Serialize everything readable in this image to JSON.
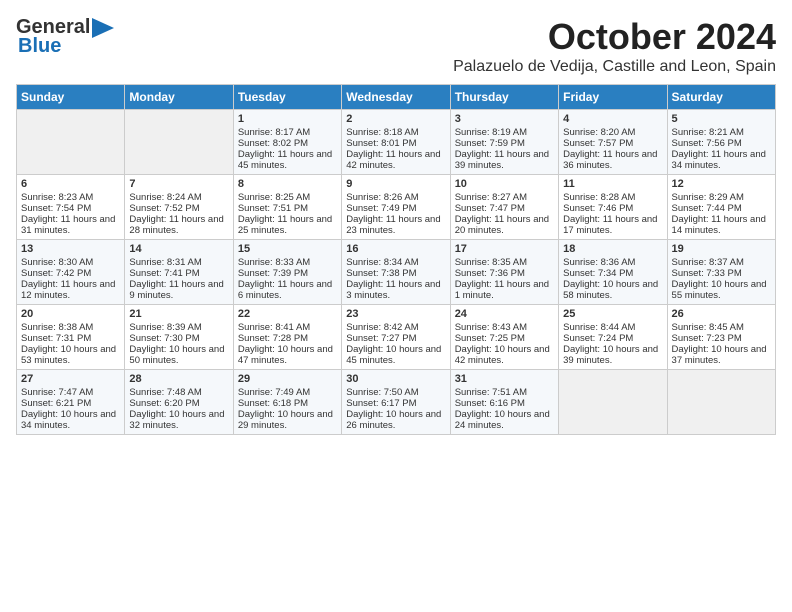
{
  "header": {
    "logo_line1": "General",
    "logo_line2": "Blue",
    "month": "October 2024",
    "location": "Palazuelo de Vedija, Castille and Leon, Spain"
  },
  "days_of_week": [
    "Sunday",
    "Monday",
    "Tuesday",
    "Wednesday",
    "Thursday",
    "Friday",
    "Saturday"
  ],
  "weeks": [
    [
      {
        "day": "",
        "content": ""
      },
      {
        "day": "",
        "content": ""
      },
      {
        "day": "1",
        "content": "Sunrise: 8:17 AM\nSunset: 8:02 PM\nDaylight: 11 hours and 45 minutes."
      },
      {
        "day": "2",
        "content": "Sunrise: 8:18 AM\nSunset: 8:01 PM\nDaylight: 11 hours and 42 minutes."
      },
      {
        "day": "3",
        "content": "Sunrise: 8:19 AM\nSunset: 7:59 PM\nDaylight: 11 hours and 39 minutes."
      },
      {
        "day": "4",
        "content": "Sunrise: 8:20 AM\nSunset: 7:57 PM\nDaylight: 11 hours and 36 minutes."
      },
      {
        "day": "5",
        "content": "Sunrise: 8:21 AM\nSunset: 7:56 PM\nDaylight: 11 hours and 34 minutes."
      }
    ],
    [
      {
        "day": "6",
        "content": "Sunrise: 8:23 AM\nSunset: 7:54 PM\nDaylight: 11 hours and 31 minutes."
      },
      {
        "day": "7",
        "content": "Sunrise: 8:24 AM\nSunset: 7:52 PM\nDaylight: 11 hours and 28 minutes."
      },
      {
        "day": "8",
        "content": "Sunrise: 8:25 AM\nSunset: 7:51 PM\nDaylight: 11 hours and 25 minutes."
      },
      {
        "day": "9",
        "content": "Sunrise: 8:26 AM\nSunset: 7:49 PM\nDaylight: 11 hours and 23 minutes."
      },
      {
        "day": "10",
        "content": "Sunrise: 8:27 AM\nSunset: 7:47 PM\nDaylight: 11 hours and 20 minutes."
      },
      {
        "day": "11",
        "content": "Sunrise: 8:28 AM\nSunset: 7:46 PM\nDaylight: 11 hours and 17 minutes."
      },
      {
        "day": "12",
        "content": "Sunrise: 8:29 AM\nSunset: 7:44 PM\nDaylight: 11 hours and 14 minutes."
      }
    ],
    [
      {
        "day": "13",
        "content": "Sunrise: 8:30 AM\nSunset: 7:42 PM\nDaylight: 11 hours and 12 minutes."
      },
      {
        "day": "14",
        "content": "Sunrise: 8:31 AM\nSunset: 7:41 PM\nDaylight: 11 hours and 9 minutes."
      },
      {
        "day": "15",
        "content": "Sunrise: 8:33 AM\nSunset: 7:39 PM\nDaylight: 11 hours and 6 minutes."
      },
      {
        "day": "16",
        "content": "Sunrise: 8:34 AM\nSunset: 7:38 PM\nDaylight: 11 hours and 3 minutes."
      },
      {
        "day": "17",
        "content": "Sunrise: 8:35 AM\nSunset: 7:36 PM\nDaylight: 11 hours and 1 minute."
      },
      {
        "day": "18",
        "content": "Sunrise: 8:36 AM\nSunset: 7:34 PM\nDaylight: 10 hours and 58 minutes."
      },
      {
        "day": "19",
        "content": "Sunrise: 8:37 AM\nSunset: 7:33 PM\nDaylight: 10 hours and 55 minutes."
      }
    ],
    [
      {
        "day": "20",
        "content": "Sunrise: 8:38 AM\nSunset: 7:31 PM\nDaylight: 10 hours and 53 minutes."
      },
      {
        "day": "21",
        "content": "Sunrise: 8:39 AM\nSunset: 7:30 PM\nDaylight: 10 hours and 50 minutes."
      },
      {
        "day": "22",
        "content": "Sunrise: 8:41 AM\nSunset: 7:28 PM\nDaylight: 10 hours and 47 minutes."
      },
      {
        "day": "23",
        "content": "Sunrise: 8:42 AM\nSunset: 7:27 PM\nDaylight: 10 hours and 45 minutes."
      },
      {
        "day": "24",
        "content": "Sunrise: 8:43 AM\nSunset: 7:25 PM\nDaylight: 10 hours and 42 minutes."
      },
      {
        "day": "25",
        "content": "Sunrise: 8:44 AM\nSunset: 7:24 PM\nDaylight: 10 hours and 39 minutes."
      },
      {
        "day": "26",
        "content": "Sunrise: 8:45 AM\nSunset: 7:23 PM\nDaylight: 10 hours and 37 minutes."
      }
    ],
    [
      {
        "day": "27",
        "content": "Sunrise: 7:47 AM\nSunset: 6:21 PM\nDaylight: 10 hours and 34 minutes."
      },
      {
        "day": "28",
        "content": "Sunrise: 7:48 AM\nSunset: 6:20 PM\nDaylight: 10 hours and 32 minutes."
      },
      {
        "day": "29",
        "content": "Sunrise: 7:49 AM\nSunset: 6:18 PM\nDaylight: 10 hours and 29 minutes."
      },
      {
        "day": "30",
        "content": "Sunrise: 7:50 AM\nSunset: 6:17 PM\nDaylight: 10 hours and 26 minutes."
      },
      {
        "day": "31",
        "content": "Sunrise: 7:51 AM\nSunset: 6:16 PM\nDaylight: 10 hours and 24 minutes."
      },
      {
        "day": "",
        "content": ""
      },
      {
        "day": "",
        "content": ""
      }
    ]
  ]
}
